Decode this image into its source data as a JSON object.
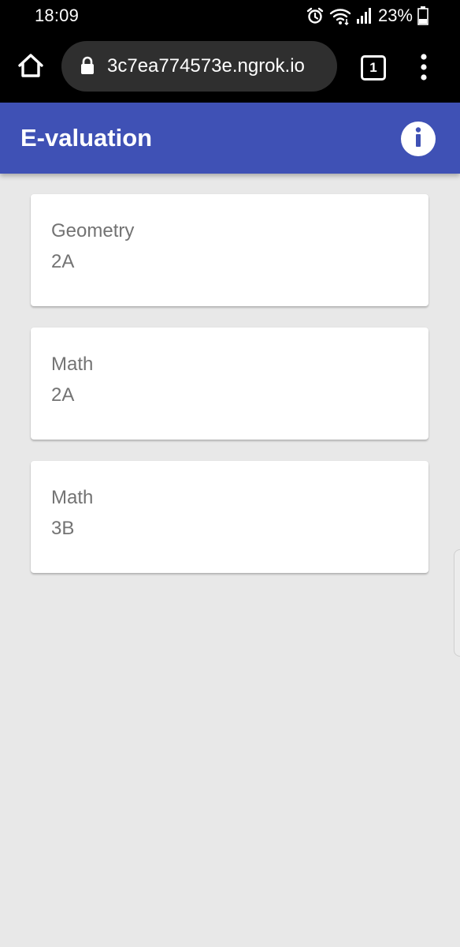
{
  "status_bar": {
    "time": "18:09",
    "battery_percent": "23%",
    "icons": [
      "alarm-icon",
      "wifi-icon",
      "signal-icon",
      "battery-icon"
    ]
  },
  "browser": {
    "url": "3c7ea774573e.ngrok.io",
    "tab_count": "1",
    "icons": [
      "home-icon",
      "lock-icon",
      "more-vert-icon"
    ]
  },
  "app_bar": {
    "title": "E-valuation",
    "info_icon": "info-icon",
    "color": "#3f51b5"
  },
  "cards": [
    {
      "subject": "Geometry",
      "class": "2A"
    },
    {
      "subject": "Math",
      "class": "2A"
    },
    {
      "subject": "Math",
      "class": "3B"
    }
  ],
  "colors": {
    "background": "#e8e8e8",
    "card": "#ffffff",
    "card_text": "#737373"
  }
}
